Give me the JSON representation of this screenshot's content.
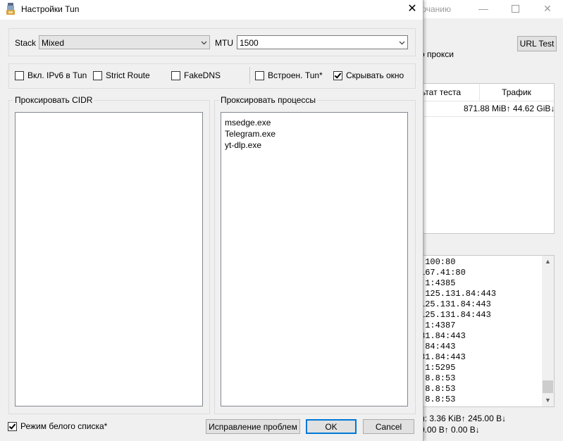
{
  "background_window": {
    "title_fragment": "ючанию",
    "url_test_button": "URL Test",
    "proxy_label_fragment": "о прокси",
    "table": {
      "col_result_fragment": "ьтат теста",
      "col_traffic": "Трафик",
      "row_traffic": "871.88 MiB↑ 44.62 GiB↓"
    },
    "log_lines": [
      ".100:80",
      "167.41:80",
      ".1:4385",
      ".125.131.84:443",
      "125.131.84:443",
      "125.131.84:443",
      ".1:4387",
      "31.84:443",
      ".84:443",
      "31.84:443",
      ".1:5295",
      ".8.8:53",
      ".8.8:53",
      ".8.8:53"
    ],
    "speed_line1": "и: 3.36 KiB↑ 245.00 B↓",
    "speed_line2": "0.00 B↑ 0.00 B↓"
  },
  "dialog": {
    "title": "Настройки Tun",
    "stack": {
      "label": "Stack",
      "value": "Mixed"
    },
    "mtu": {
      "label": "MTU",
      "value": "1500"
    },
    "options": [
      {
        "label": "Вкл. IPv6 в Tun",
        "checked": false
      },
      {
        "label": "Strict Route",
        "checked": false
      },
      {
        "label": "FakeDNS",
        "checked": false
      },
      {
        "label": "Встроен. Tun*",
        "checked": false
      },
      {
        "label": "Скрывать окно",
        "checked": true
      }
    ],
    "proxy_cidr": {
      "title": "Проксировать CIDR",
      "items": []
    },
    "proxy_processes": {
      "title": "Проксировать процессы",
      "items": [
        "msedge.exe",
        "Telegram.exe",
        "yt-dlp.exe"
      ]
    },
    "whitelist": {
      "label": "Режим белого списка*",
      "checked": true
    },
    "buttons": {
      "troubleshoot": "Исправление проблем",
      "ok": "OK",
      "cancel": "Cancel"
    }
  },
  "colors": {
    "accent": "#0078d7",
    "window_bg": "#f0f0f0",
    "border": "#adadad"
  }
}
